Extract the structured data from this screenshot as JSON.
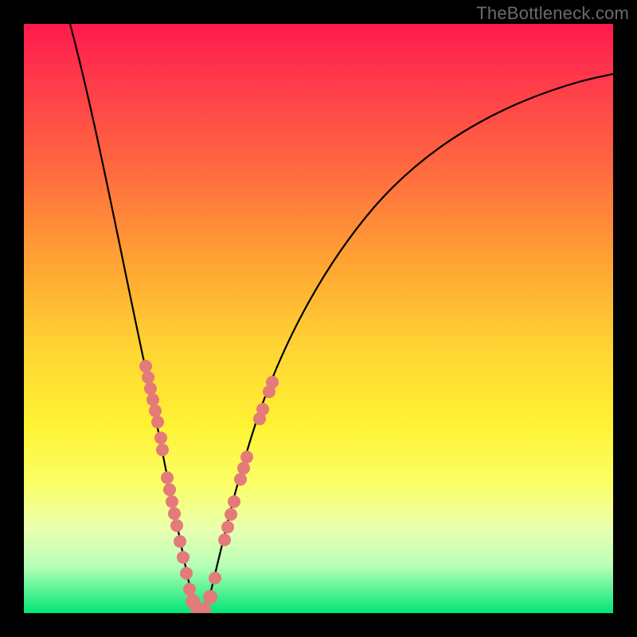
{
  "watermark": "TheBottleneck.com",
  "chart_data": {
    "type": "line",
    "title": "",
    "xlabel": "",
    "ylabel": "",
    "xlim": [
      0,
      100
    ],
    "ylim": [
      0,
      100
    ],
    "x": [
      8,
      10,
      12,
      14,
      16,
      18,
      20,
      22,
      23,
      24,
      25,
      26,
      27,
      28,
      29,
      30,
      32,
      34,
      36,
      38,
      42,
      46,
      50,
      55,
      60,
      65,
      70,
      75,
      80,
      85,
      90,
      95,
      99
    ],
    "y": [
      100,
      95,
      89,
      83,
      76,
      68,
      59,
      48,
      42,
      36,
      29,
      22,
      15,
      8,
      3,
      0,
      4,
      11,
      18,
      25,
      37,
      47,
      55,
      62,
      68,
      73,
      77,
      80,
      83,
      85,
      87,
      89,
      90
    ],
    "series": [
      {
        "name": "bottleneck-curve",
        "note": "V-shaped curve; minimum near x≈29 where bottleneck % is ~0 (green zone)"
      }
    ],
    "highlighted_points": {
      "note": "salmon-colored sample dots overlaid near the curve around the valley",
      "left_branch_x": [
        20,
        20.5,
        21,
        21.5,
        22,
        23,
        24,
        24.5,
        25,
        26,
        27,
        28,
        29
      ],
      "right_branch_x": [
        30,
        31,
        32,
        33,
        34,
        34.5,
        35,
        36,
        37,
        38
      ]
    }
  }
}
